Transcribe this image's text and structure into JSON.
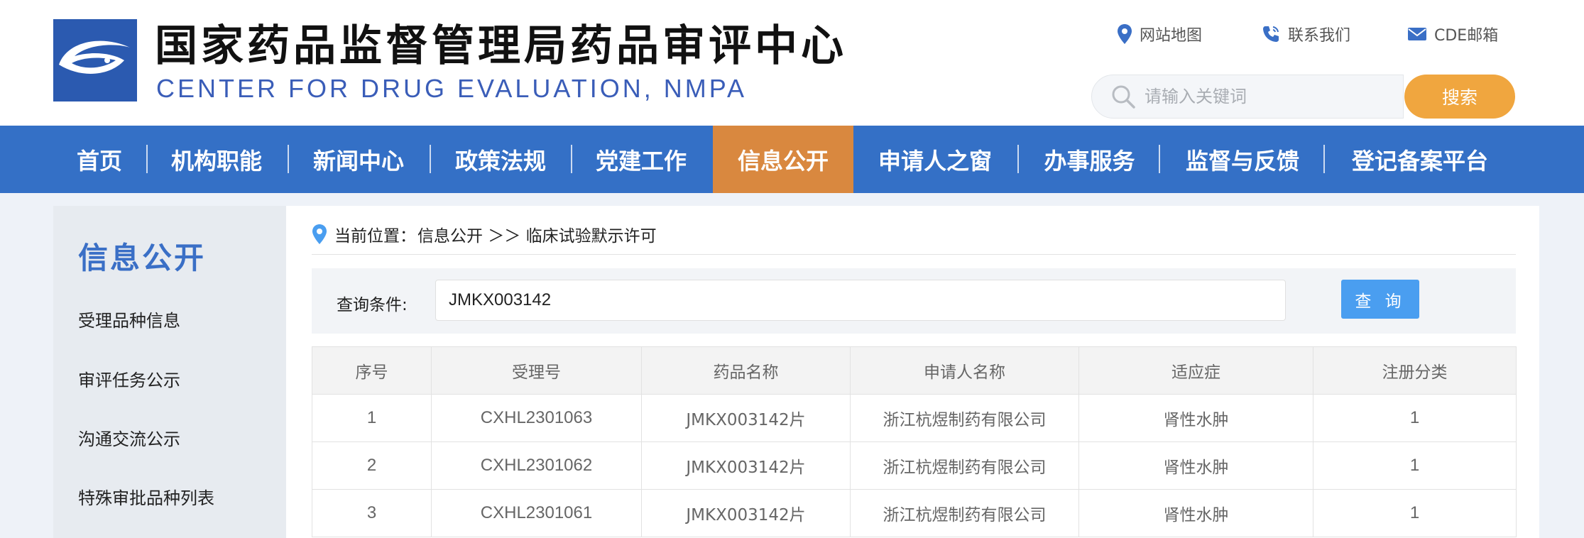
{
  "header": {
    "title": "国家药品监督管理局药品审评中心",
    "subtitle": "CENTER FOR DRUG EVALUATION, NMPA",
    "links": [
      {
        "label": "网站地图",
        "icon": "location-pin-icon"
      },
      {
        "label": "联系我们",
        "icon": "phone-icon"
      },
      {
        "label": "CDE邮箱",
        "icon": "mail-icon"
      }
    ],
    "search": {
      "placeholder": "请输入关键词",
      "button": "搜索"
    }
  },
  "nav": {
    "items": [
      "首页",
      "机构职能",
      "新闻中心",
      "政策法规",
      "党建工作",
      "信息公开",
      "申请人之窗",
      "办事服务",
      "监督与反馈",
      "登记备案平台"
    ],
    "active": "信息公开"
  },
  "sidebar": {
    "title": "信息公开",
    "items": [
      "受理品种信息",
      "审评任务公示",
      "沟通交流公示",
      "特殊审批品种列表"
    ]
  },
  "breadcrumb": {
    "prefix": "当前位置：",
    "path": "信息公开 ＞＞ 临床试验默示许可"
  },
  "query": {
    "label": "查询条件:",
    "value": "JMKX003142",
    "button": "查 询"
  },
  "table": {
    "headers": [
      "序号",
      "受理号",
      "药品名称",
      "申请人名称",
      "适应症",
      "注册分类"
    ],
    "rows": [
      [
        "1",
        "CXHL2301063",
        "JMKX003142片",
        "浙江杭煜制药有限公司",
        "肾性水肿",
        "1"
      ],
      [
        "2",
        "CXHL2301062",
        "JMKX003142片",
        "浙江杭煜制药有限公司",
        "肾性水肿",
        "1"
      ],
      [
        "3",
        "CXHL2301061",
        "JMKX003142片",
        "浙江杭煜制药有限公司",
        "肾性水肿",
        "1"
      ]
    ]
  },
  "colors": {
    "nav_bg": "#3470c6",
    "nav_active": "#d9883f",
    "search_button": "#f0a63f",
    "query_button": "#4a9ef0",
    "subtitle": "#3a5db8"
  }
}
